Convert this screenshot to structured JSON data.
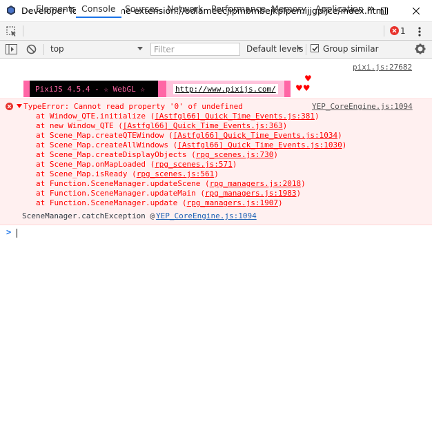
{
  "window": {
    "title": "Developer Tools - chrome-extension://odlameecjipmbmbejkplpemijjgpljce/index.html"
  },
  "tabs": [
    {
      "label": "Elements"
    },
    {
      "label": "Console"
    },
    {
      "label": "Sources"
    },
    {
      "label": "Network"
    },
    {
      "label": "Performance"
    },
    {
      "label": "Memory"
    },
    {
      "label": "Application"
    }
  ],
  "tabbar": {
    "more_label": "»",
    "error_count": "1"
  },
  "toolbar": {
    "context": "top",
    "filter_placeholder": "Filter",
    "levels_label": "Default levels",
    "group_similar_label": "Group similar",
    "group_similar_checked": true
  },
  "console": {
    "banner": {
      "source": "pixi.js:27682",
      "text": "PixiJS 4.5.4 - ☆ WebGL ☆",
      "url": "http://www.pixijs.com/",
      "hearts_top": "♥",
      "hearts_bottom": "♥♥"
    },
    "error": {
      "prefix": "TypeError: Cannot read property '0' of undefined",
      "source": "YEP_CoreEngine.js:1094",
      "stack": [
        {
          "fn": "at Window_QTE.initialize (",
          "file": "[Astfgl66]_Quick_Time_Events.js:381",
          "end": ")"
        },
        {
          "fn": "at new Window_QTE (",
          "file": "[Astfgl66]_Quick_Time_Events.js:363",
          "end": ")"
        },
        {
          "fn": "at Scene_Map.createQTEWindow (",
          "file": "[Astfgl66]_Quick_Time_Events.js:1034",
          "end": ")"
        },
        {
          "fn": "at Scene_Map.createAllWindows (",
          "file": "[Astfgl66]_Quick_Time_Events.js:1030",
          "end": ")"
        },
        {
          "fn": "at Scene_Map.createDisplayObjects (",
          "file": "rpg_scenes.js:730",
          "end": ")"
        },
        {
          "fn": "at Scene_Map.onMapLoaded (",
          "file": "rpg_scenes.js:571",
          "end": ")"
        },
        {
          "fn": "at Scene_Map.isReady (",
          "file": "rpg_scenes.js:561",
          "end": ")"
        },
        {
          "fn": "at Function.SceneManager.updateScene (",
          "file": "rpg_managers.js:2018",
          "end": ")"
        },
        {
          "fn": "at Function.SceneManager.updateMain (",
          "file": "rpg_managers.js:1983",
          "end": ")"
        },
        {
          "fn": "at Function.SceneManager.update (",
          "file": "rpg_managers.js:1907",
          "end": ")"
        }
      ],
      "catch_label": "SceneManager.catchException @ ",
      "catch_source": "YEP_CoreEngine.js:1094"
    },
    "prompt": ">"
  },
  "colors": {
    "error_text": "#ff0000",
    "error_bg": "#fff0f0",
    "accent": "#1a73e8",
    "banner_pink": "#ff66a5",
    "banner_black": "#000000"
  }
}
